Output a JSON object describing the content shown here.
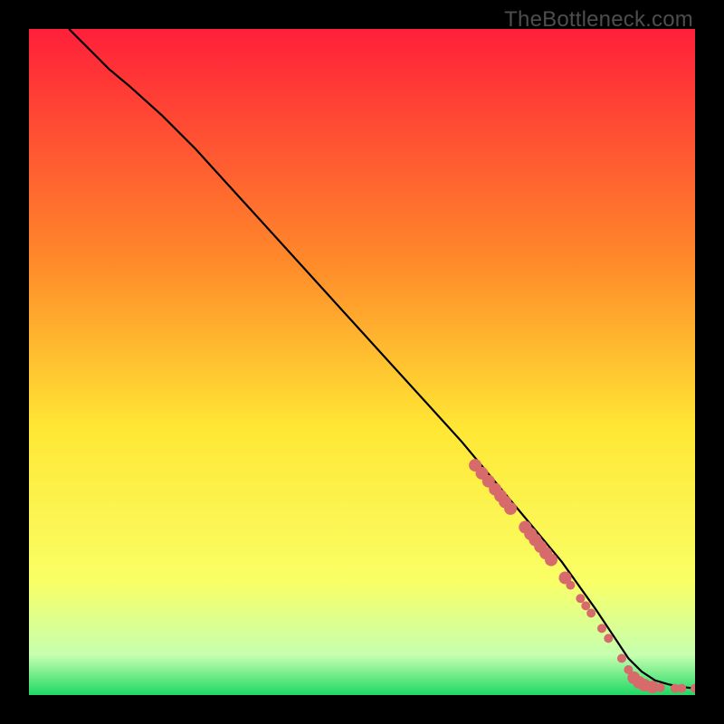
{
  "watermark": "TheBottleneck.com",
  "colors": {
    "point": "#d76a6a",
    "line": "#000000",
    "gradient_top": "#ff1f3a",
    "gradient_mid1": "#ff8a2a",
    "gradient_mid2": "#ffe734",
    "gradient_mid3": "#f9ff66",
    "gradient_mid4": "#c6ffb0",
    "gradient_bottom": "#1fd964"
  },
  "chart_data": {
    "type": "line",
    "title": "",
    "xlabel": "",
    "ylabel": "",
    "xlim": [
      0,
      100
    ],
    "ylim": [
      0,
      100
    ],
    "grid": false,
    "legend": false,
    "series": [
      {
        "name": "curve",
        "x": [
          6,
          8,
          10,
          12,
          15,
          20,
          25,
          30,
          35,
          40,
          45,
          50,
          55,
          60,
          65,
          70,
          75,
          80,
          85,
          88,
          90,
          92,
          94,
          96,
          98,
          100
        ],
        "y": [
          100,
          98,
          96,
          94,
          91.5,
          87,
          82,
          76.5,
          71,
          65.5,
          60,
          54.5,
          49,
          43.5,
          38,
          32,
          26,
          20,
          13,
          8.5,
          5.5,
          3.5,
          2.2,
          1.6,
          1.2,
          1.0
        ]
      }
    ],
    "points": {
      "name": "data-points",
      "color": "#d76a6a",
      "r_small": 5,
      "r_large": 7,
      "xy": [
        [
          67,
          34.5
        ],
        [
          68,
          33.3
        ],
        [
          69,
          32.1
        ],
        [
          70,
          30.9
        ],
        [
          70.8,
          29.9
        ],
        [
          71.5,
          29.0
        ],
        [
          72.3,
          28.0
        ],
        [
          74.5,
          25.2
        ],
        [
          75.3,
          24.2
        ],
        [
          76.0,
          23.3
        ],
        [
          76.8,
          22.3
        ],
        [
          77.6,
          21.3
        ],
        [
          78.4,
          20.3
        ],
        [
          80.5,
          17.6
        ],
        [
          81.3,
          16.5
        ],
        [
          82.8,
          14.5
        ],
        [
          83.6,
          13.4
        ],
        [
          84.4,
          12.3
        ],
        [
          86.0,
          10.0
        ],
        [
          87.0,
          8.5
        ],
        [
          89.0,
          5.5
        ],
        [
          90.0,
          3.8
        ],
        [
          90.8,
          2.6
        ],
        [
          91.6,
          1.9
        ],
        [
          92.4,
          1.5
        ],
        [
          93.6,
          1.2
        ],
        [
          94.8,
          1.1
        ],
        [
          97.0,
          1.0
        ],
        [
          98.0,
          1.0
        ],
        [
          100.0,
          1.0
        ]
      ]
    }
  }
}
